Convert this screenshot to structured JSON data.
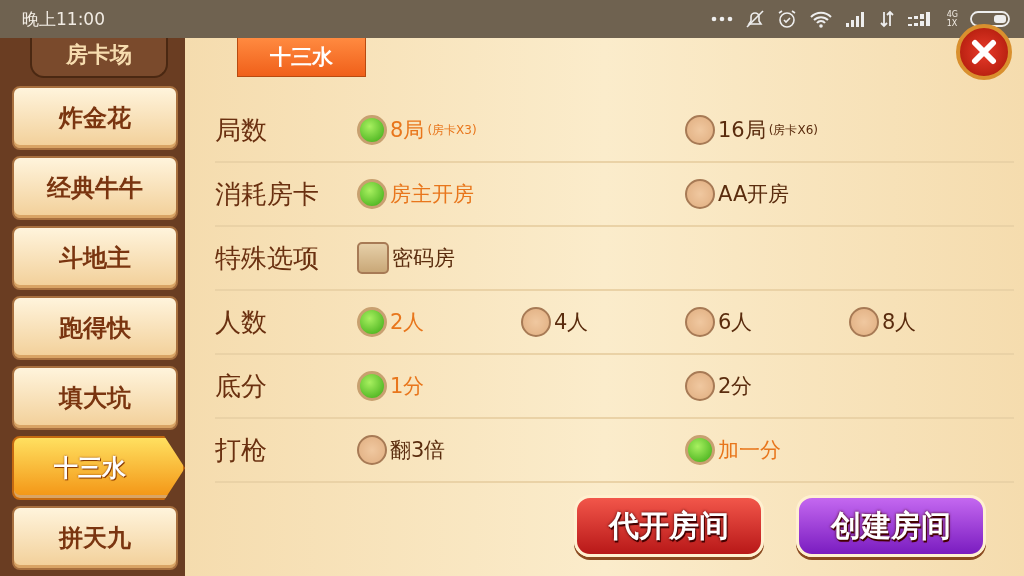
{
  "status_bar": {
    "time": "晚上11:00",
    "network_type": "4G",
    "network_mode": "1X"
  },
  "sidebar": {
    "title": "房卡场",
    "items": [
      {
        "label": "炸金花",
        "selected": false
      },
      {
        "label": "经典牛牛",
        "selected": false
      },
      {
        "label": "斗地主",
        "selected": false
      },
      {
        "label": "跑得快",
        "selected": false
      },
      {
        "label": "填大坑",
        "selected": false
      },
      {
        "label": "十三水",
        "selected": true
      },
      {
        "label": "拼天九",
        "selected": false
      }
    ]
  },
  "panel": {
    "tab": "十三水",
    "settings": [
      {
        "label": "局数",
        "kind": "radio",
        "options": [
          {
            "label": "8局",
            "note": "(房卡X3)",
            "selected": true
          },
          {
            "label": "16局",
            "note": "(房卡X6)",
            "selected": false
          }
        ]
      },
      {
        "label": "消耗房卡",
        "kind": "radio",
        "options": [
          {
            "label": "房主开房",
            "selected": true
          },
          {
            "label": "AA开房",
            "selected": false
          }
        ]
      },
      {
        "label": "特殊选项",
        "kind": "checkbox",
        "options": [
          {
            "label": "密码房",
            "checked": false
          }
        ]
      },
      {
        "label": "人数",
        "kind": "radio",
        "options": [
          {
            "label": "2人",
            "selected": true
          },
          {
            "label": "4人",
            "selected": false
          },
          {
            "label": "6人",
            "selected": false
          },
          {
            "label": "8人",
            "selected": false
          }
        ]
      },
      {
        "label": "底分",
        "kind": "radio",
        "options": [
          {
            "label": "1分",
            "selected": true
          },
          {
            "label": "2分",
            "selected": false
          }
        ]
      },
      {
        "label": "打枪",
        "kind": "radio",
        "options": [
          {
            "label": "翻3倍",
            "selected": false
          },
          {
            "label": "加一分",
            "selected": true
          }
        ]
      }
    ],
    "buttons": [
      {
        "label": "代开房间",
        "kind": "secondary"
      },
      {
        "label": "创建房间",
        "kind": "primary"
      }
    ]
  }
}
